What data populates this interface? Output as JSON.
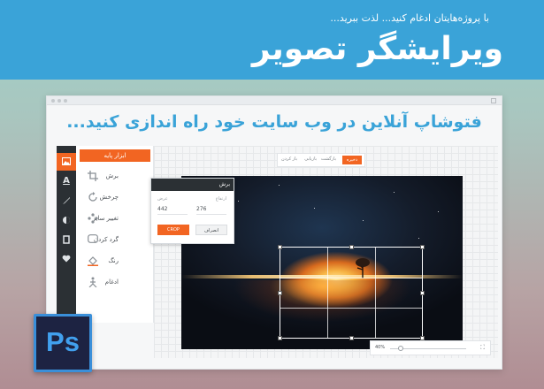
{
  "banner": {
    "tagline": "با پروژه‌هایتان ادغام کنید... لذت ببرید...",
    "title": "ویرایشگر تصویر"
  },
  "headline": "فتوشاپ آنلاین در وب سایت خود راه اندازی کنید...",
  "strip_icons": [
    "image-icon",
    "text-icon",
    "brush-icon",
    "shape-icon",
    "frame-icon",
    "heart-icon"
  ],
  "panel": {
    "header": "ابزار پایه",
    "tools": [
      {
        "label": "برش",
        "icon": "crop-icon"
      },
      {
        "label": "چرخش",
        "icon": "rotate-icon"
      },
      {
        "label": "تغییر سایز",
        "icon": "resize-icon"
      },
      {
        "label": "گرد کردن",
        "icon": "round-corners-icon"
      },
      {
        "label": "رنگ",
        "icon": "color-fill-icon"
      },
      {
        "label": "ادغام",
        "icon": "merge-icon"
      }
    ]
  },
  "topbar": {
    "save": "ذخیره",
    "items": [
      "بازگشت",
      "بازیابی",
      "باز کردن"
    ]
  },
  "crop_dialog": {
    "title": "برش",
    "width_label": "عرض",
    "height_label": "ارتفاع",
    "width_value": "442",
    "height_value": "276",
    "crop_button": "CROP",
    "cancel_button": "انصراف"
  },
  "zoom": {
    "label": "40%",
    "level": 0.4
  },
  "logo": "Ps",
  "colors": {
    "accent": "#f26522",
    "banner": "#3aa3d8",
    "dark": "#2b3034"
  }
}
